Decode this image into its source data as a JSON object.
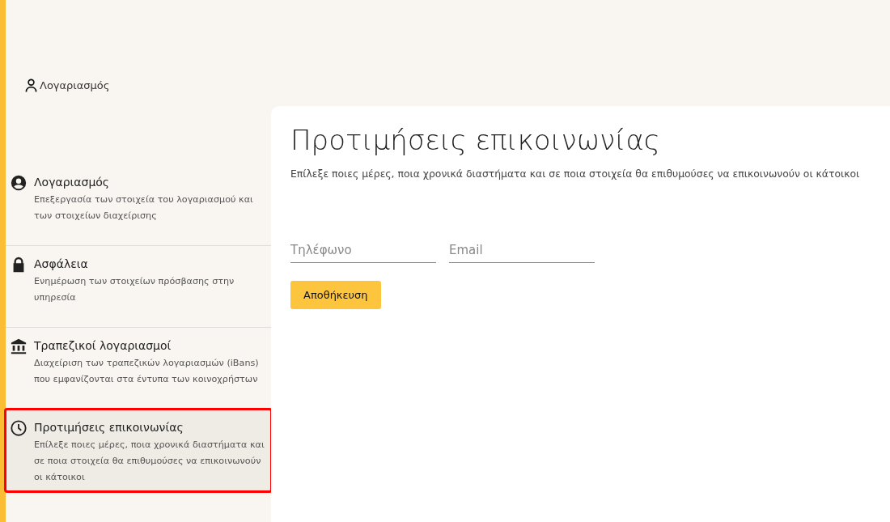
{
  "header": {
    "account_link": "Λογαριασμός"
  },
  "sidebar": {
    "items": [
      {
        "kind": "account",
        "title": "Λογαριασμός",
        "description": "Επεξεργασία των στοιχεία του λογαριασμού και των στοιχείων διαχείρισης",
        "selected": false
      },
      {
        "kind": "security",
        "title": "Ασφάλεια",
        "description": "Ενημέρωση των στοιχείων πρόσβασης στην υπηρεσία",
        "selected": false
      },
      {
        "kind": "bank",
        "title": "Τραπεζικοί λογαριασμοί",
        "description": "Διαχείριση των τραπεζικών λογαριασμών (iBans) που εμφανίζονται στα έντυπα των κοινοχρήστων",
        "selected": false
      },
      {
        "kind": "contact",
        "title": "Προτιμήσεις επικοινωνίας",
        "description": "Επίλεξε ποιες μέρες, ποια χρονικά διαστήματα και σε ποια στοιχεία θα επιθυμούσες να επικοινωνούν οι κάτοικοι",
        "selected": true
      }
    ]
  },
  "main": {
    "title": "Προτιμήσεις επικοινωνίας",
    "description": "Επίλεξε ποιες μέρες, ποια χρονικά διαστήματα και σε ποια στοιχεία θα επιθυμούσες να επικοινωνούν οι κάτοικοι",
    "fields": [
      {
        "placeholder": "Τηλέφωνο"
      },
      {
        "placeholder": "Email"
      }
    ],
    "save_button": "Αποθήκευση"
  }
}
